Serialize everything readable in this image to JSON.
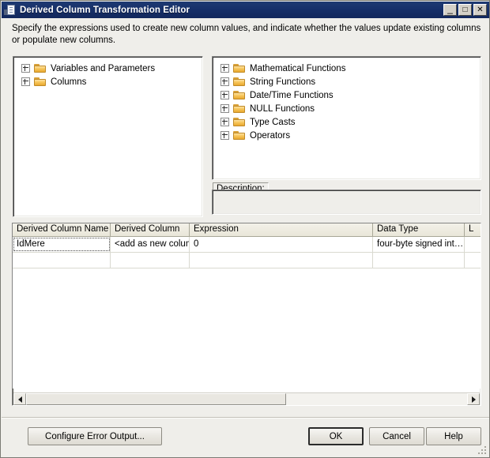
{
  "window": {
    "title": "Derived Column Transformation Editor",
    "icon": "document-window-icon",
    "minimize_label": "_",
    "maximize_label": "□",
    "close_label": "✕"
  },
  "intro": {
    "text": "Specify the expressions used to create new column values, and indicate whether the values update existing columns or populate new columns."
  },
  "left_tree": {
    "items": [
      {
        "label": "Variables and Parameters",
        "icon": "folder-icon",
        "expander": "plus-icon"
      },
      {
        "label": "Columns",
        "icon": "folder-icon",
        "expander": "plus-icon"
      }
    ]
  },
  "right_tree": {
    "items": [
      {
        "label": "Mathematical Functions",
        "icon": "folder-icon",
        "expander": "plus-icon"
      },
      {
        "label": "String Functions",
        "icon": "folder-icon",
        "expander": "plus-icon"
      },
      {
        "label": "Date/Time Functions",
        "icon": "folder-icon",
        "expander": "plus-icon"
      },
      {
        "label": "NULL Functions",
        "icon": "folder-icon",
        "expander": "plus-icon"
      },
      {
        "label": "Type Casts",
        "icon": "folder-icon",
        "expander": "plus-icon"
      },
      {
        "label": "Operators",
        "icon": "folder-icon",
        "expander": "plus-icon"
      }
    ]
  },
  "description": {
    "label": "Description:",
    "value": ""
  },
  "grid": {
    "columns": [
      "Derived Column Name",
      "Derived Column",
      "Expression",
      "Data Type",
      "L"
    ],
    "rows": [
      {
        "derived_column_name": "IdMere",
        "derived_column": "<add as new column>",
        "expression": "0",
        "data_type": "four-byte signed int…",
        "length": ""
      },
      {
        "derived_column_name": "",
        "derived_column": "",
        "expression": "",
        "data_type": "",
        "length": ""
      }
    ],
    "scrollbar": {
      "left_arrow": "scroll-left-icon",
      "right_arrow": "scroll-right-icon",
      "thumb_fraction": "59%"
    }
  },
  "footer": {
    "configure_error_output": "Configure Error Output...",
    "ok": "OK",
    "cancel": "Cancel",
    "help": "Help"
  },
  "colors": {
    "titlebar": "#17306a",
    "dialog_bg": "#efeeea",
    "grid_header": "#ece9dd",
    "folder": "#f7c860"
  }
}
